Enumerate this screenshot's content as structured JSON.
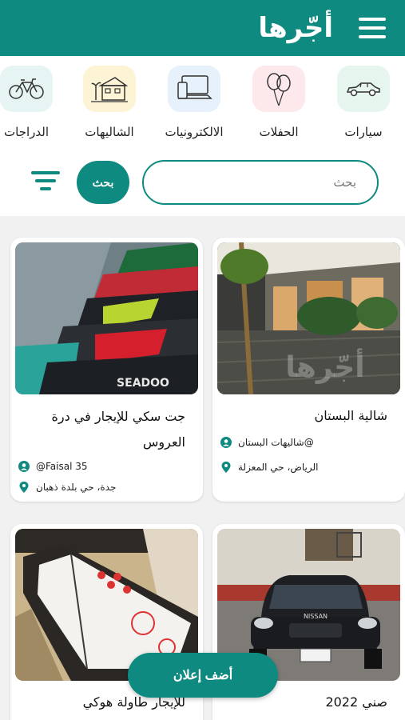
{
  "header": {
    "title": "أجّرها",
    "menu_icon": "hamburger-icon"
  },
  "categories": [
    {
      "label": "سيارات",
      "icon": "car-icon",
      "bg": "#e7f5ef"
    },
    {
      "label": "الحفلات",
      "icon": "balloons-icon",
      "bg": "#fde9ec"
    },
    {
      "label": "الالكترونيات",
      "icon": "electronics-icon",
      "bg": "#e6f1fb"
    },
    {
      "label": "الشاليهات",
      "icon": "chalet-icon",
      "bg": "#fdf4d6"
    },
    {
      "label": "الدراجات",
      "icon": "bicycle-icon",
      "bg": "#e6f5f3"
    }
  ],
  "search": {
    "placeholder": "بحث",
    "button_label": "بحث",
    "filter_icon": "filter-icon"
  },
  "listings": [
    {
      "title": "شالية البستان",
      "owner": "@شاليهات البستان",
      "location": "الرياض، حي المعزلة",
      "watermark": "أجّرها"
    },
    {
      "title": "جت سكي للإيجار في درة العروس",
      "owner": "@Faisal 35",
      "location": "جدة، حي بلدة ذهبان",
      "image_text": "SEADOO"
    },
    {
      "title": "صني 2022",
      "owner": "",
      "location": "",
      "image_text": "NISSAN"
    },
    {
      "title": "للإيجار طاولة هوكي",
      "owner": "",
      "location": ""
    }
  ],
  "fab": {
    "label": "أضف إعلان"
  },
  "colors": {
    "primary": "#0f8a80",
    "background": "#f1f1f1"
  }
}
